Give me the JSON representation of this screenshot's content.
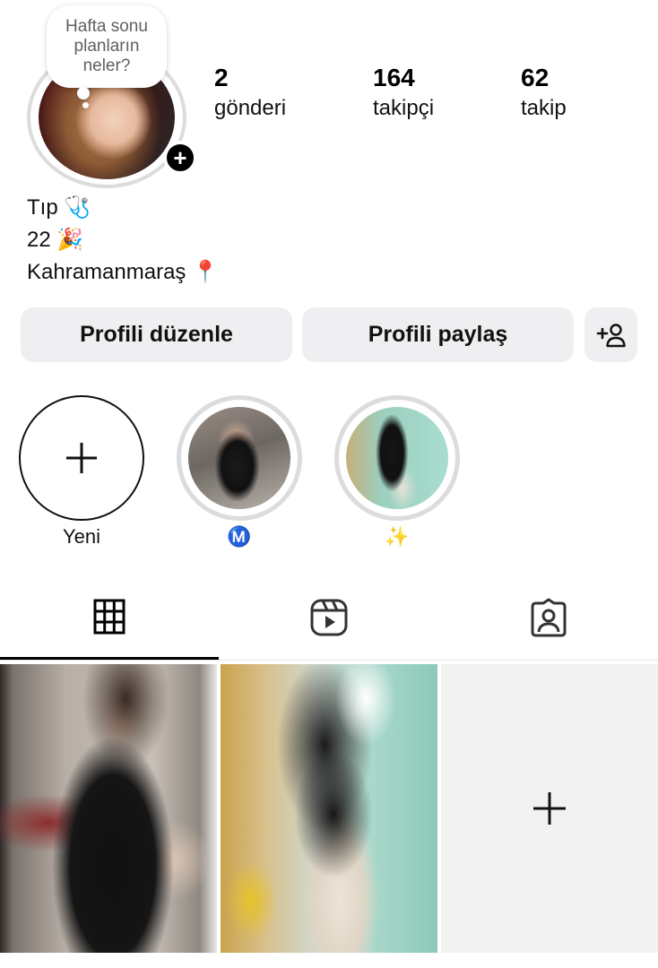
{
  "profile": {
    "note_lines": [
      "Hafta sonu",
      "planların",
      "neler?"
    ],
    "avatar_add_glyph": "+"
  },
  "stats": [
    {
      "value": "2",
      "label": "gönderi"
    },
    {
      "value": "164",
      "label": "takipçi"
    },
    {
      "value": "62",
      "label": "takip"
    }
  ],
  "bio": {
    "line1": "Tıp 🩺",
    "line2": "22 🎉",
    "line3": "Kahramanmaraş 📍"
  },
  "buttons": {
    "edit_profile": "Profili düzenle",
    "share_profile": "Profili paylaş",
    "discover_people_icon": "add-person-icon"
  },
  "highlights": [
    {
      "label": "Yeni",
      "type": "new"
    },
    {
      "label": "Ⓜ️",
      "type": "story"
    },
    {
      "label": "✨",
      "type": "story"
    }
  ],
  "tabs": [
    {
      "icon": "grid-icon",
      "active": true
    },
    {
      "icon": "reels-icon",
      "active": false
    },
    {
      "icon": "tagged-icon",
      "active": false
    }
  ],
  "posts": [
    {
      "type": "photo"
    },
    {
      "type": "photo"
    },
    {
      "type": "add",
      "glyph": "+"
    }
  ],
  "colors": {
    "button_bg": "#efeff2",
    "ring_gray": "#dcdcdc",
    "text": "#000000",
    "highlight_m": "#1da1f2"
  }
}
